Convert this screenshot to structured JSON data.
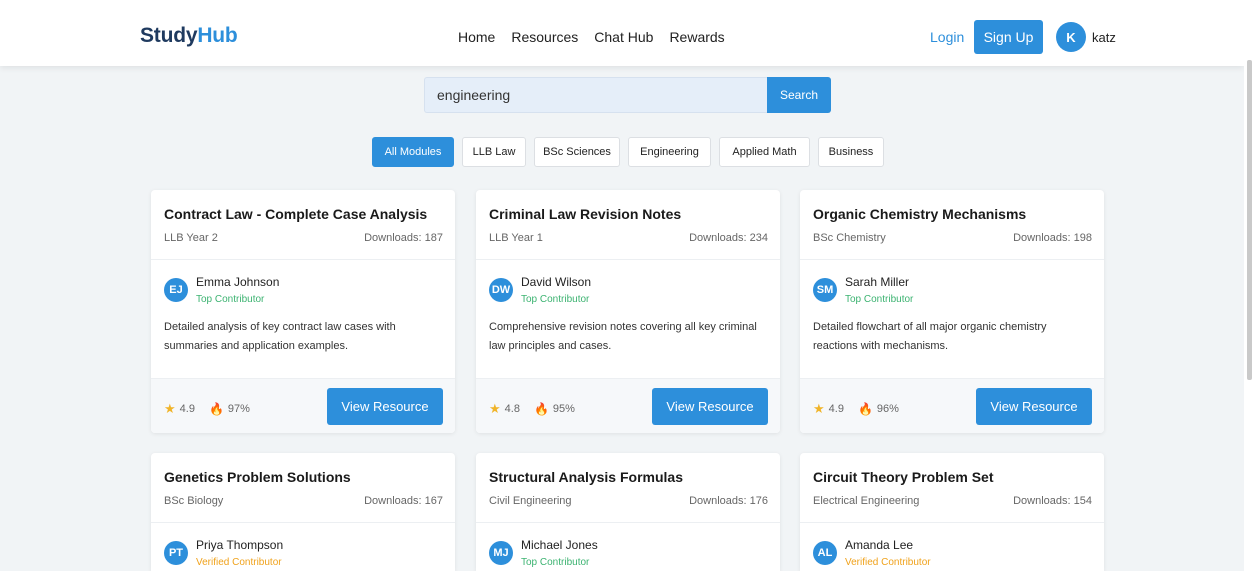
{
  "header": {
    "logo_part1": "Study",
    "logo_part2": "Hub",
    "nav": [
      "Home",
      "Resources",
      "Chat Hub",
      "Rewards"
    ],
    "login_label": "Login",
    "signup_label": "Sign Up",
    "user_initial": "K",
    "username": "katz"
  },
  "search": {
    "value": "engineering",
    "button_label": "Search"
  },
  "filters": [
    "All Modules",
    "LLB Law",
    "BSc Sciences",
    "Engineering",
    "Applied Math",
    "Business"
  ],
  "active_filter": "All Modules",
  "cards": [
    {
      "title": "Contract Law - Complete Case Analysis",
      "meta": "LLB Year 2",
      "downloads": "Downloads: 187",
      "author_initials": "EJ",
      "author_name": "Emma Johnson",
      "author_badge": "Top Contributor",
      "description": "Detailed analysis of key contract law cases with summaries and application examples.",
      "rating": "4.9",
      "score": "97%",
      "button_label": "View Resource"
    },
    {
      "title": "Criminal Law Revision Notes",
      "meta": "LLB Year 1",
      "downloads": "Downloads: 234",
      "author_initials": "DW",
      "author_name": "David Wilson",
      "author_badge": "Top Contributor",
      "description": "Comprehensive revision notes covering all key criminal law principles and cases.",
      "rating": "4.8",
      "score": "95%",
      "button_label": "View Resource"
    },
    {
      "title": "Organic Chemistry Mechanisms",
      "meta": "BSc Chemistry",
      "downloads": "Downloads: 198",
      "author_initials": "SM",
      "author_name": "Sarah Miller",
      "author_badge": "Top Contributor",
      "description": "Detailed flowchart of all major organic chemistry reactions with mechanisms.",
      "rating": "4.9",
      "score": "96%",
      "button_label": "View Resource"
    },
    {
      "title": "Genetics Problem Solutions",
      "meta": "BSc Biology",
      "downloads": "Downloads: 167",
      "author_initials": "PT",
      "author_name": "Priya Thompson",
      "author_badge": "Verified Contributor"
    },
    {
      "title": "Structural Analysis Formulas",
      "meta": "Civil Engineering",
      "downloads": "Downloads: 176",
      "author_initials": "MJ",
      "author_name": "Michael Jones",
      "author_badge": "Top Contributor"
    },
    {
      "title": "Circuit Theory Problem Set",
      "meta": "Electrical Engineering",
      "downloads": "Downloads: 154",
      "author_initials": "AL",
      "author_name": "Amanda Lee",
      "author_badge": "Verified Contributor"
    }
  ],
  "colors": {
    "accent": "#2d8fdb",
    "top_contributor": "#3cb371",
    "verified_contributor": "#f0a21b",
    "star": "#f0b429"
  },
  "icons": {
    "rating": "star-icon",
    "score": "fire-icon"
  }
}
